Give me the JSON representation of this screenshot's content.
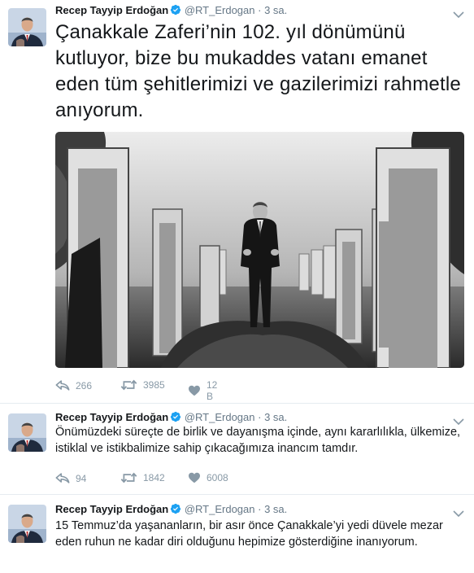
{
  "tweets": [
    {
      "name": "Recep Tayyip Erdoğan",
      "handle": "@RT_Erdogan",
      "separator": "·",
      "time": "3 sa.",
      "text": "Çanakkale Zaferi’nin 102. yıl dönümünü kutluyor, bize bu mukaddes vatanı emanet eden tüm şehitlerimizi ve gazilerimizi rahmetle anıyorum.",
      "reply_count": "266",
      "retweet_count": "3985",
      "like_count": "12 B"
    },
    {
      "name": "Recep Tayyip Erdoğan",
      "handle": "@RT_Erdogan",
      "separator": "·",
      "time": "3 sa.",
      "text": "Önümüzdeki süreçte de birlik ve dayanışma içinde, aynı kararlılıkla, ülkemize, istiklal ve istikbalimize sahip çıkacağımıza inancım tamdır.",
      "reply_count": "94",
      "retweet_count": "1842",
      "like_count": "6008"
    },
    {
      "name": "Recep Tayyip Erdoğan",
      "handle": "@RT_Erdogan",
      "separator": "·",
      "time": "3 sa.",
      "text": "15 Temmuz’da yaşananların, bir asır önce Çanakkale’yi yedi düvele mezar eden ruhun ne kadar diri olduğunu hepimize gösterdiğine inanıyorum."
    }
  ],
  "colors": {
    "verified": "#1da1f2",
    "muted": "#657786",
    "icon": "#8899a6",
    "divider": "#e6ecf0"
  },
  "icons": [
    "verified-badge-icon",
    "caret-down-icon",
    "reply-icon",
    "retweet-icon",
    "heart-icon"
  ]
}
